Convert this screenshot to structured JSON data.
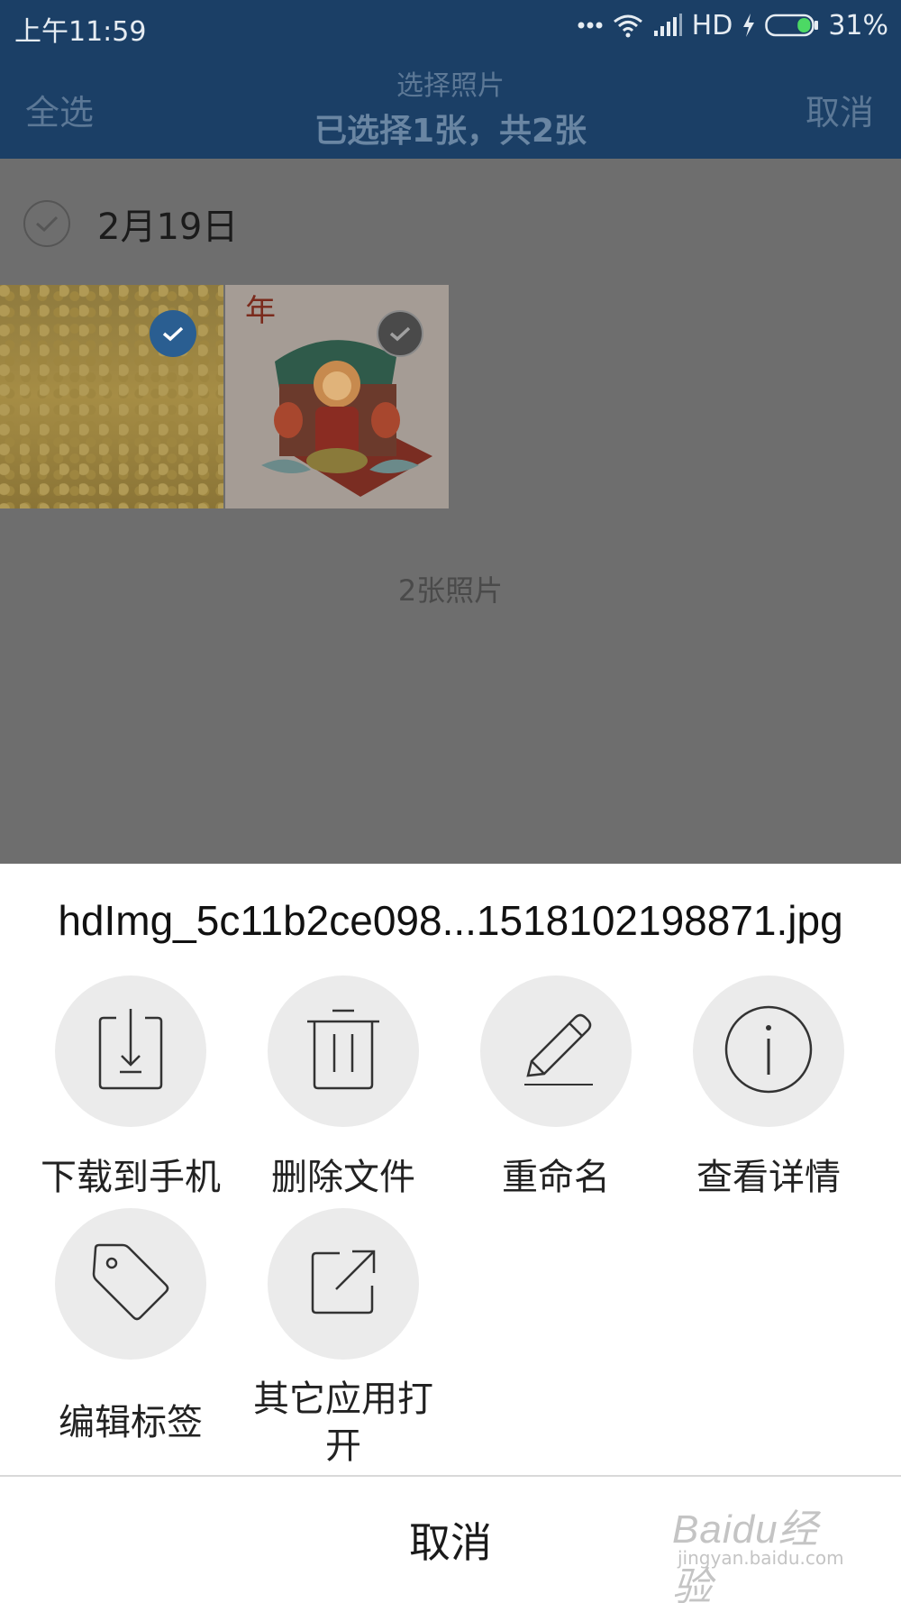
{
  "status_bar": {
    "time": "上午11:59",
    "network": "HD",
    "battery": "31%",
    "battery_level": 0.31
  },
  "header": {
    "select_all": "全选",
    "title": "选择照片",
    "subtitle": "已选择1张，共2张",
    "cancel": "取消"
  },
  "content": {
    "date_label": "2月19日",
    "photo_count": "2张照片"
  },
  "sheet": {
    "file_name": "hdImg_5c11b2ce098...1518102198871.jpg",
    "actions": [
      {
        "label": "下载到手机",
        "icon": "download-icon"
      },
      {
        "label": "删除文件",
        "icon": "trash-icon"
      },
      {
        "label": "重命名",
        "icon": "pencil-icon"
      },
      {
        "label": "查看详情",
        "icon": "info-icon"
      },
      {
        "label": "编辑标签",
        "icon": "tag-icon"
      },
      {
        "label": "其它应用打开",
        "icon": "open-external-icon"
      }
    ],
    "cancel": "取消"
  },
  "watermark": {
    "brand": "Baidu经验",
    "url": "jingyan.baidu.com"
  },
  "colors": {
    "header_bg": "#1b3f66",
    "overlay": "#6e6e6e",
    "sheet_bg": "#ffffff",
    "action_circle": "#ebebeb",
    "selected_check": "#2a5e91"
  }
}
